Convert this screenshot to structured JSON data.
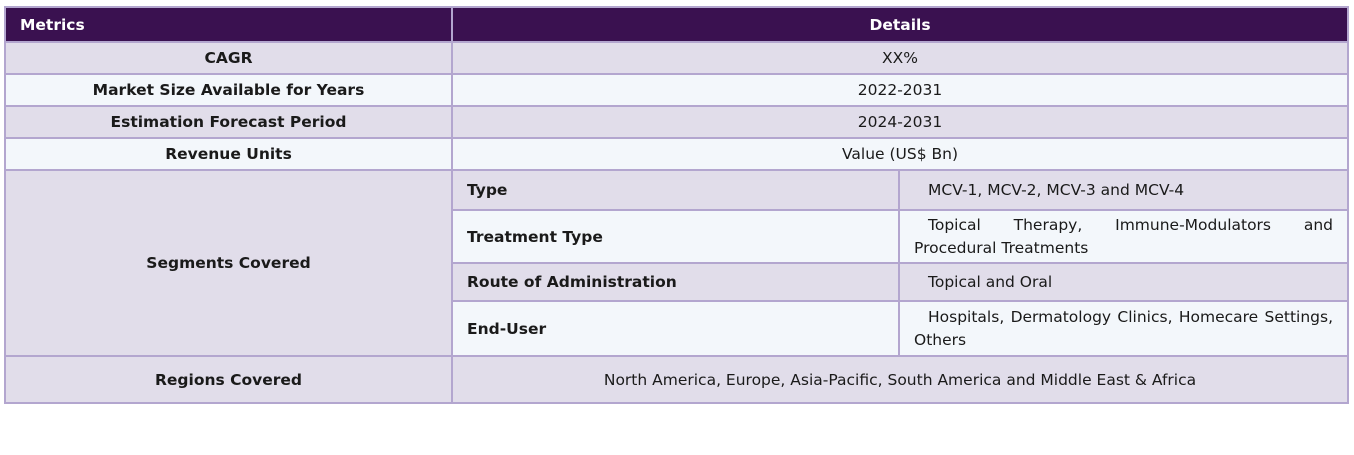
{
  "headers": {
    "metrics": "Metrics",
    "details": "Details"
  },
  "rows": {
    "cagr": {
      "label": "CAGR",
      "value": "XX%"
    },
    "market_size": {
      "label": "Market Size Available for Years",
      "value": "2022-2031"
    },
    "forecast": {
      "label": "Estimation Forecast Period",
      "value": "2024-2031"
    },
    "revenue": {
      "label": "Revenue Units",
      "value": "Value (US$ Bn)"
    },
    "segments": {
      "label": "Segments Covered",
      "items": [
        {
          "name": "Type",
          "value": "MCV-1, MCV-2, MCV-3 and MCV-4"
        },
        {
          "name": "Treatment Type",
          "value": "Topical Therapy, Immune-Modulators and Procedural Treatments"
        },
        {
          "name": "Route of Administration",
          "value": "Topical and Oral"
        },
        {
          "name": "End-User",
          "value": "Hospitals, Dermatology Clinics, Homecare Settings, Others"
        }
      ]
    },
    "regions": {
      "label": "Regions Covered",
      "value": "North America, Europe, Asia-Pacific, South America and Middle East & Africa"
    }
  },
  "colors": {
    "header_bg": "#3a1150",
    "row_shade": "#e1ddea",
    "row_light": "#f3f7fb",
    "border": "#b3a6cf"
  }
}
